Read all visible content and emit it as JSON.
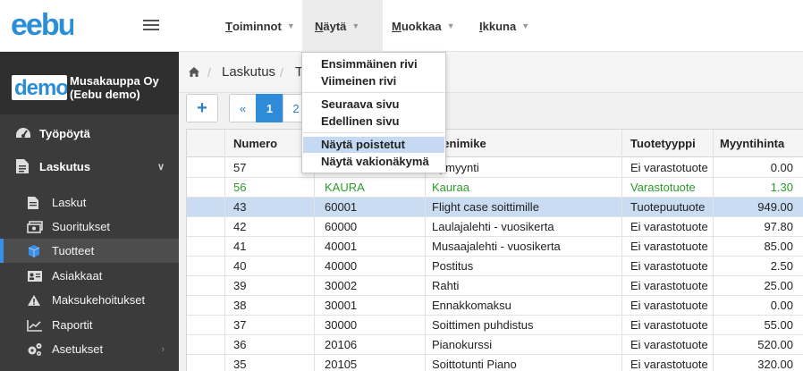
{
  "header": {
    "logo_text": "eebu",
    "menus": [
      {
        "label": "Toiminnot",
        "ul": "T",
        "rest": "oiminnot"
      },
      {
        "label": "Näytä",
        "ul": "N",
        "rest": "äytä"
      },
      {
        "label": "Muokkaa",
        "ul": "M",
        "rest": "uokkaa"
      },
      {
        "label": "Ikkuna",
        "ul": "I",
        "rest": "kkuna"
      }
    ],
    "caret": "▼"
  },
  "dropdown": {
    "groups": [
      [
        "Ensimmäinen rivi",
        "Viimeinen rivi"
      ],
      [
        "Seuraava sivu",
        "Edellinen sivu"
      ],
      [
        "Näytä poistetut",
        "Näytä vakionäkymä"
      ]
    ],
    "highlighted": "Näytä poistetut"
  },
  "company": {
    "logo_text": "demo",
    "name_line1": "Musakauppa Oy",
    "name_line2": "(Eebu demo)"
  },
  "sidebar": {
    "top_items": [
      {
        "label": "Työpöytä",
        "icon": "dashboard-icon"
      },
      {
        "label": "Laskutus",
        "icon": "invoice-icon",
        "chevron": "∨"
      }
    ],
    "sub_items": [
      {
        "label": "Laskut",
        "icon": "document-icon"
      },
      {
        "label": "Suoritukset",
        "icon": "money-icon"
      },
      {
        "label": "Tuotteet",
        "icon": "box-icon",
        "active": true
      },
      {
        "label": "Asiakkaat",
        "icon": "address-card-icon"
      },
      {
        "label": "Maksukehoitukset",
        "icon": "warning-icon"
      },
      {
        "label": "Raportit",
        "icon": "chart-icon"
      },
      {
        "label": "Asetukset",
        "icon": "gears-icon",
        "chevron": "›"
      }
    ]
  },
  "breadcrumb": {
    "items": [
      "Laskutus",
      "T"
    ]
  },
  "toolbar": {
    "add_label": "+",
    "pager": [
      "«",
      "1",
      "2"
    ]
  },
  "table": {
    "columns": [
      "Numero",
      "",
      "Tuotenimike",
      "Tuotetyyppi",
      "Myyntihinta"
    ],
    "col2_visible": "otenimike",
    "rows": [
      {
        "num": "57",
        "code": "",
        "name": "rrymyynti",
        "type": "Ei varastotuote",
        "price": "0.00"
      },
      {
        "num": "56",
        "code": "KAURA",
        "name": "Kauraa",
        "type": "Varastotuote",
        "price": "1.30",
        "deleted": true
      },
      {
        "num": "43",
        "code": "60001",
        "name": "Flight case soittimille",
        "type": "Tuotepuutuote",
        "price": "949.00",
        "selected": true
      },
      {
        "num": "42",
        "code": "60000",
        "name": "Laulajalehti - vuosikerta",
        "type": "Ei varastotuote",
        "price": "97.80"
      },
      {
        "num": "41",
        "code": "40001",
        "name": "Musaajalehti - vuosikerta",
        "type": "Ei varastotuote",
        "price": "85.00"
      },
      {
        "num": "40",
        "code": "40000",
        "name": "Postitus",
        "type": "Ei varastotuote",
        "price": "2.50"
      },
      {
        "num": "39",
        "code": "30002",
        "name": "Rahti",
        "type": "Ei varastotuote",
        "price": "25.00"
      },
      {
        "num": "38",
        "code": "30001",
        "name": "Ennakkomaksu",
        "type": "Ei varastotuote",
        "price": "0.00"
      },
      {
        "num": "37",
        "code": "30000",
        "name": "Soittimen puhdistus",
        "type": "Ei varastotuote",
        "price": "55.00"
      },
      {
        "num": "36",
        "code": "20106",
        "name": "Pianokurssi",
        "type": "Ei varastotuote",
        "price": "520.00"
      },
      {
        "num": "35",
        "code": "20105",
        "name": "Soittotunti Piano",
        "type": "Ei varastotuote",
        "price": "320.00"
      }
    ]
  },
  "colors": {
    "accent": "#2e8bd8",
    "sidebar": "#3b3b3b",
    "deleted_row": "#2b9a2b",
    "selected_row": "#c9dcf1"
  }
}
